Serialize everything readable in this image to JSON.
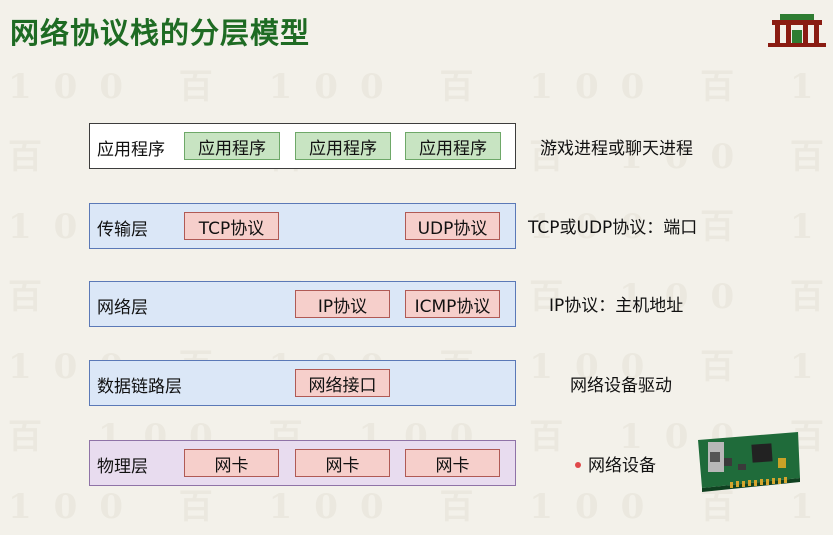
{
  "title": "网络协议栈的分层模型",
  "layers": [
    {
      "name": "应用程序",
      "boxes": [
        "应用程序",
        "应用程序",
        "应用程序"
      ],
      "description": "游戏进程或聊天进程"
    },
    {
      "name": "传输层",
      "boxes": [
        "TCP协议",
        "UDP协议"
      ],
      "description": "TCP或UDP协议：端口"
    },
    {
      "name": "网络层",
      "boxes": [
        "IP协议",
        "ICMP协议"
      ],
      "description": "IP协议：主机地址"
    },
    {
      "name": "数据链路层",
      "boxes": [
        "网络接口"
      ],
      "description": "网络设备驱动"
    },
    {
      "name": "物理层",
      "boxes": [
        "网卡",
        "网卡",
        "网卡"
      ],
      "description": "网络设备"
    }
  ],
  "colors": {
    "title": "#1e6b23",
    "app_box": "#c8e4c2",
    "protocol_box": "#f6cfcb",
    "layer_blue": "#dbe7f7",
    "layer_purple": "#e8dcef"
  },
  "icons": [
    "university-logo-icon",
    "network-card-image",
    "bullet-dot-icon"
  ]
}
